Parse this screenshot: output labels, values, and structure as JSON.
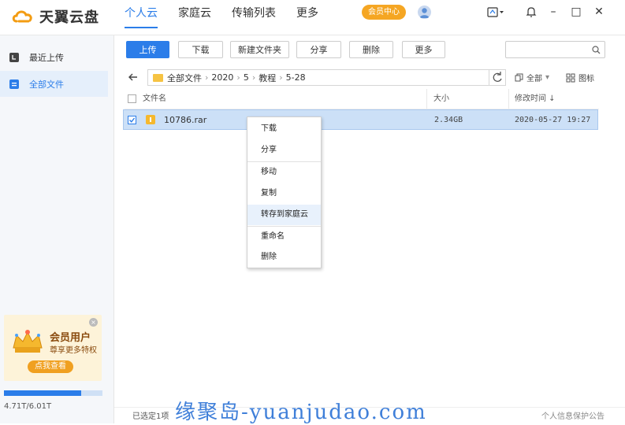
{
  "app": {
    "logo_text": "天翼云盘"
  },
  "nav": {
    "tabs": [
      {
        "label": "个人云",
        "active": true
      },
      {
        "label": "家庭云",
        "active": false
      },
      {
        "label": "传输列表",
        "active": false
      },
      {
        "label": "更多",
        "active": false
      }
    ],
    "member_center": "会员中心"
  },
  "window_controls": {
    "minimize": "–",
    "maximize": "□",
    "close": "✕"
  },
  "sidebar": {
    "items": [
      {
        "label": "最近上传",
        "icon": "recent-upload-icon",
        "active": false
      },
      {
        "label": "全部文件",
        "icon": "all-files-icon",
        "active": true
      }
    ],
    "promo": {
      "title": "会员用户",
      "subtitle": "尊享更多特权",
      "button": "点我查看"
    },
    "storage": {
      "used_fraction": 0.78,
      "text": "4.71T/6.01T"
    }
  },
  "toolbar": {
    "upload": "上传",
    "download": "下载",
    "new_folder": "新建文件夹",
    "share": "分享",
    "delete": "删除",
    "more": "更多",
    "search_placeholder": ""
  },
  "breadcrumb": {
    "items": [
      "全部文件",
      "2020",
      "5",
      "教程",
      "5-28"
    ],
    "filter_label": "全部",
    "view_label": "图标"
  },
  "table": {
    "headers": {
      "name": "文件名",
      "size": "大小",
      "modified": "修改时间 ↓"
    },
    "rows": [
      {
        "name": "10786.rar",
        "size": "2.34GB",
        "modified": "2020-05-27 19:27",
        "checked": true
      }
    ]
  },
  "context_menu": {
    "items": [
      "下载",
      "分享",
      "移动",
      "复制",
      "转存到家庭云",
      "重命名",
      "删除"
    ],
    "hovered": "转存到家庭云"
  },
  "footer": {
    "selected": "已选定1项",
    "privacy": "个人信息保护公告"
  },
  "watermark": "缘聚岛-yuanjudao.com",
  "colors": {
    "accent": "#2b7de9",
    "member": "#f5a623",
    "selected_row": "#cce0f7",
    "folder": "#f6c343"
  }
}
